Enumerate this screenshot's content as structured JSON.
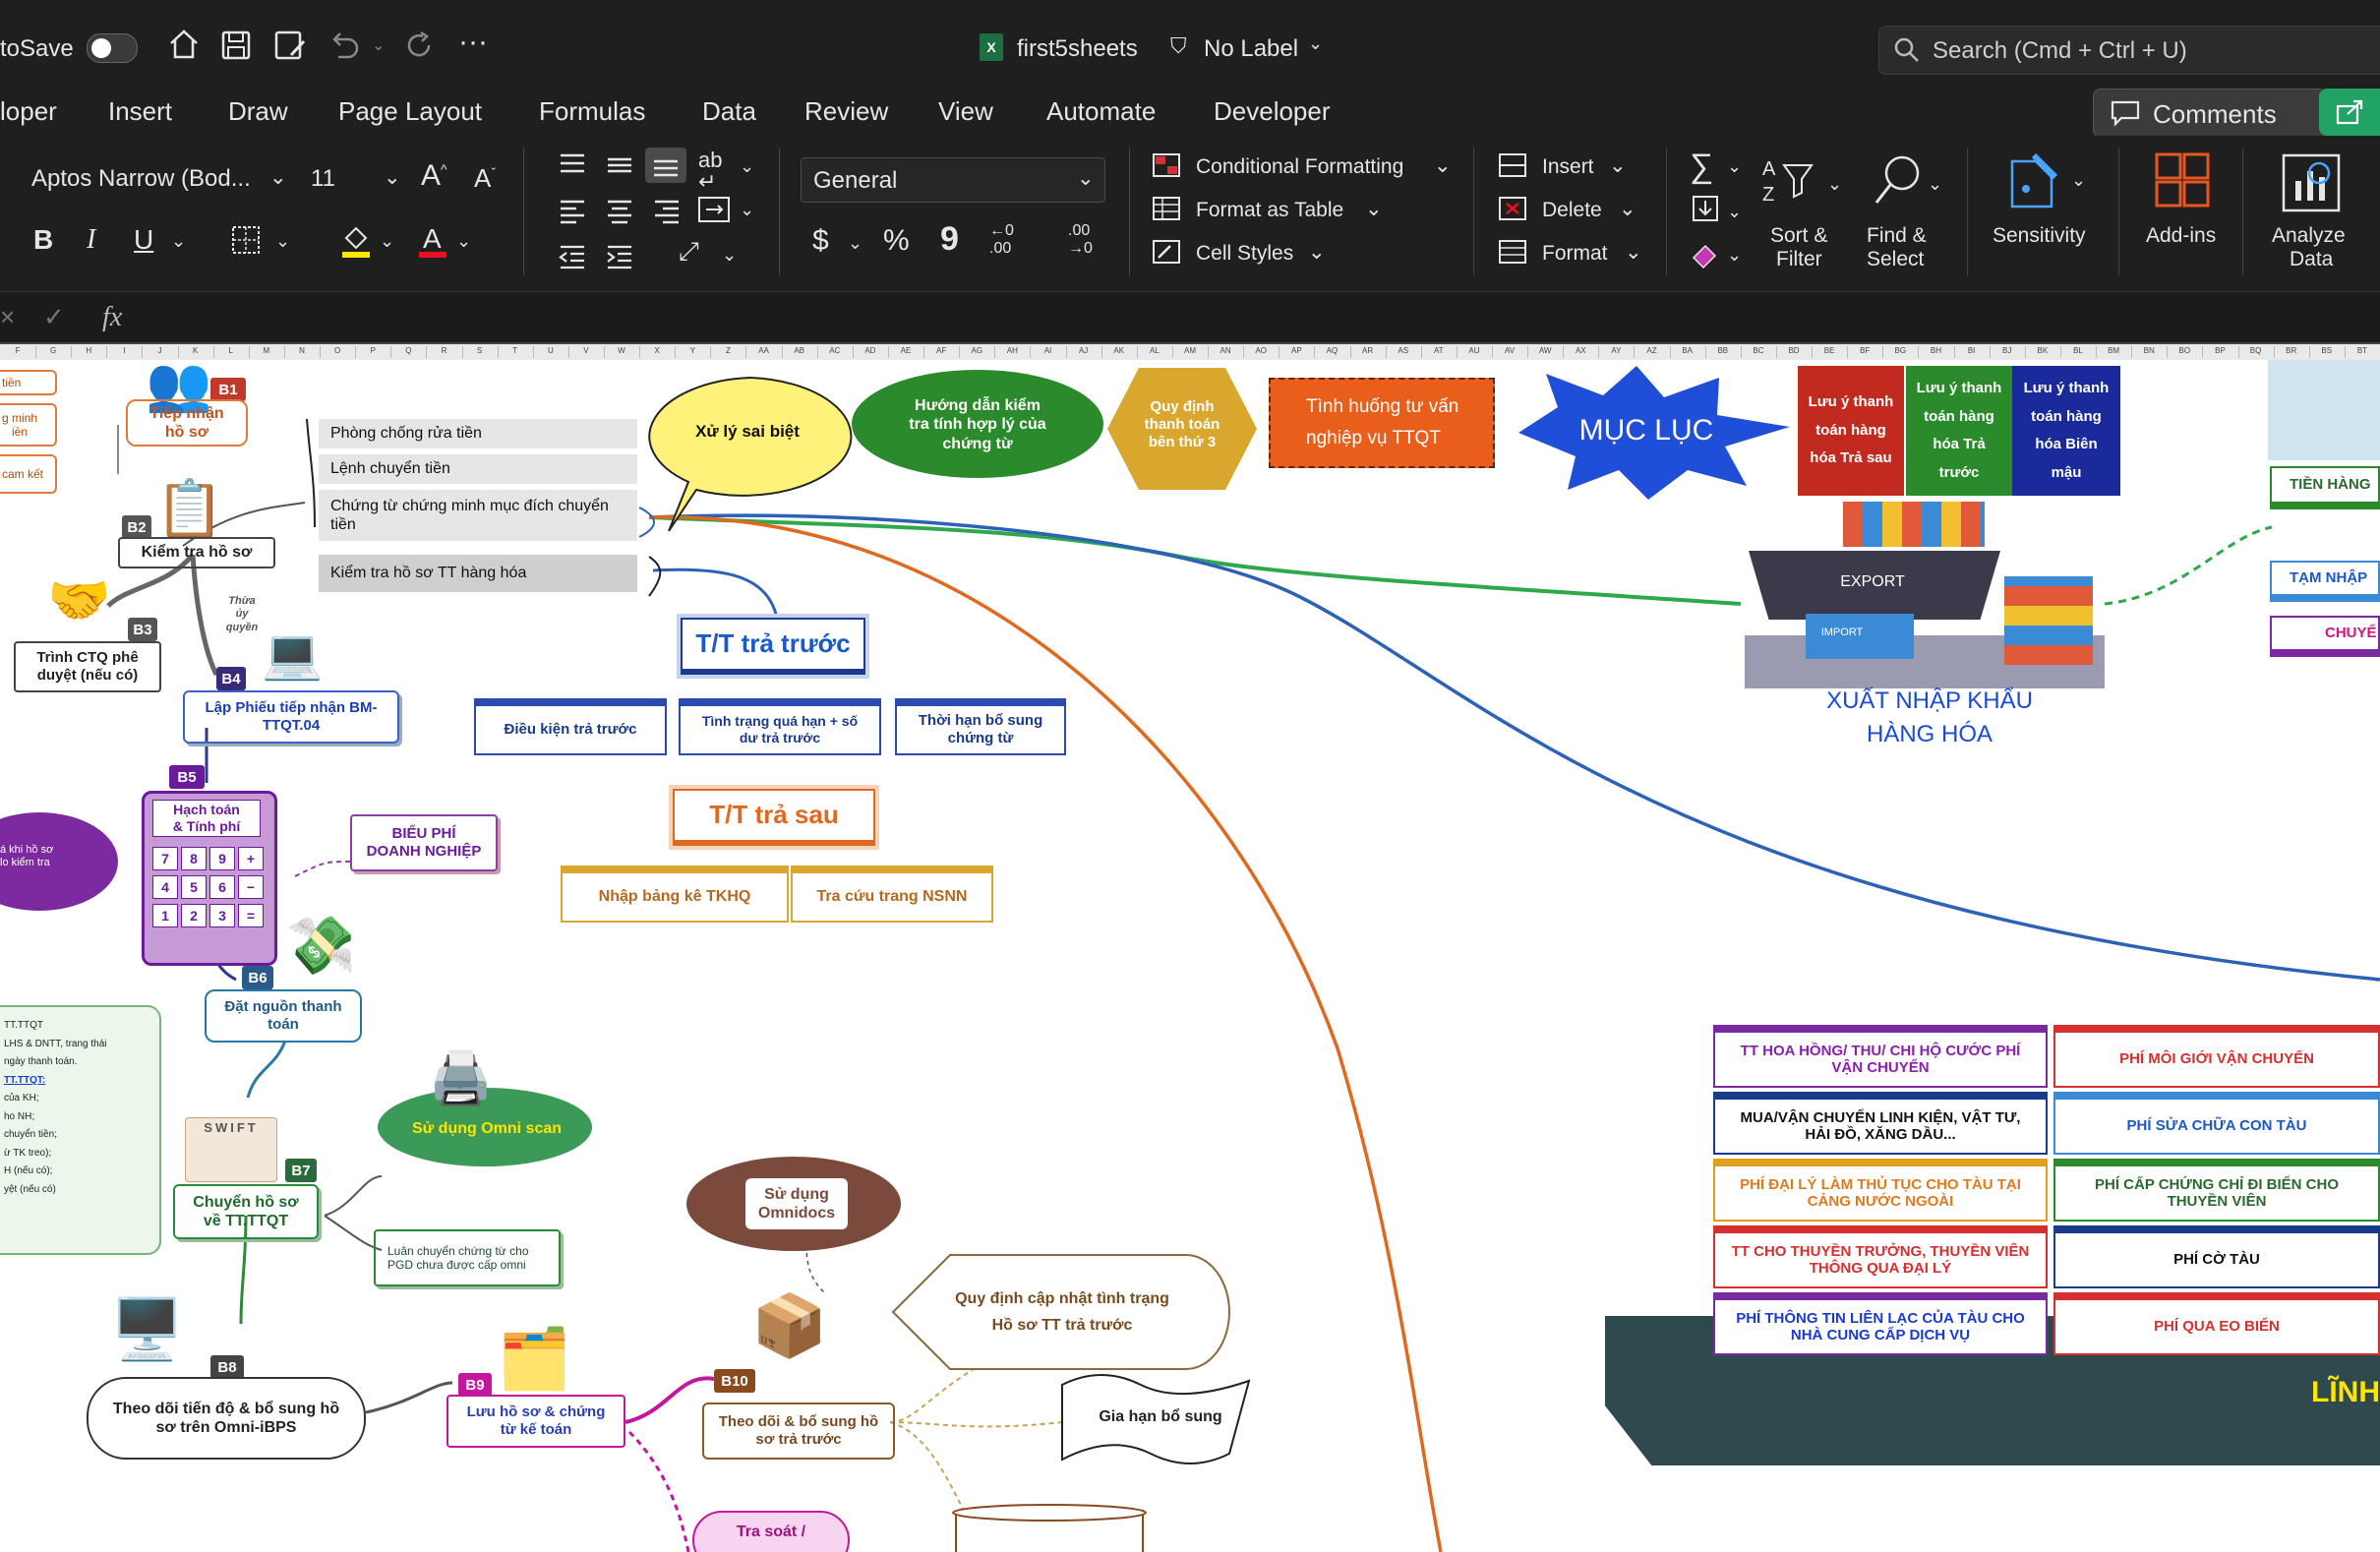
{
  "titlebar": {
    "autosave_label": "toSave",
    "filename": "first5sheets",
    "label_status": "No Label",
    "search_placeholder": "Search (Cmd + Ctrl + U)"
  },
  "menu": {
    "tabs": [
      "loper",
      "Insert",
      "Draw",
      "Page Layout",
      "Formulas",
      "Data",
      "Review",
      "View",
      "Automate",
      "Developer"
    ],
    "comments_label": "Comments"
  },
  "ribbon": {
    "font_name": "Aptos Narrow (Bod...",
    "font_size": "11",
    "number_format": "General",
    "conditional_formatting": "Conditional Formatting",
    "format_as_table": "Format as Table",
    "cell_styles": "Cell Styles",
    "insert": "Insert",
    "delete": "Delete",
    "format": "Format",
    "sort_filter_1": "Sort &",
    "sort_filter_2": "Filter",
    "find_select_1": "Find &",
    "find_select_2": "Select",
    "sensitivity": "Sensitivity",
    "addins": "Add-ins",
    "analyze_1": "Analyze",
    "analyze_2": "Data",
    "bold": "B",
    "italic": "I",
    "underline": "U",
    "currency": "$",
    "percent": "%",
    "comma": "9"
  },
  "formula": {
    "fx": "fx"
  },
  "columns": [
    "F",
    "G",
    "H",
    "I",
    "J",
    "K",
    "L",
    "M",
    "N",
    "O",
    "P",
    "Q",
    "R",
    "S",
    "T",
    "U",
    "V",
    "W",
    "X",
    "Y",
    "Z",
    "AA",
    "AB",
    "AC",
    "AD",
    "AE",
    "AF",
    "AG",
    "AH",
    "AI",
    "AJ",
    "AK",
    "AL",
    "AM",
    "AN",
    "AO",
    "AP",
    "AQ",
    "AR",
    "AS",
    "AT",
    "AU",
    "AV",
    "AW",
    "AX",
    "AY",
    "AZ",
    "BA",
    "BB",
    "BC",
    "BD",
    "BE",
    "BF",
    "BG",
    "BH",
    "BI",
    "BJ",
    "BK",
    "BL",
    "BM",
    "BN",
    "BO",
    "BP",
    "BQ",
    "BR",
    "BS",
    "BT"
  ],
  "diagram": {
    "left_partial": [
      "tiền",
      "g minh\niền",
      "cam kết"
    ],
    "b1": {
      "badge": "B1",
      "label": "Tiếp nhận\nhồ sơ"
    },
    "b2": {
      "badge": "B2",
      "label": "Kiểm tra hồ sơ"
    },
    "b3": {
      "badge": "B3",
      "label": "Trình CTQ phê\nduyệt (nếu có)"
    },
    "b3_note": "Thừa\nủy\nquyền",
    "b4": {
      "badge": "B4",
      "label": "Lập Phiếu tiếp nhận BM-\nTTQT.04"
    },
    "b5": {
      "badge": "B5",
      "label": "Hạch toán\n& Tính phí"
    },
    "b5_fee": "BIỂU PHÍ\nDOANH NGHIỆP",
    "b5_cloud": "á khi hồ sơ\nlo kiểm tra",
    "b6": {
      "badge": "B6",
      "label": "Đặt nguồn thanh\ntoán"
    },
    "b7": {
      "badge": "B7",
      "label": "Chuyển hồ sơ\nvề TT.TTQT",
      "swift": "SWIFT"
    },
    "b7_omni": "Sử dụng Omni scan",
    "b7_note": "Luân chuyển chứng từ cho\nPGD chưa được cấp omni",
    "b8": {
      "badge": "B8",
      "label": "Theo dõi tiến độ & bổ sung hồ\nsơ trên Omni-iBPS"
    },
    "b9": {
      "badge": "B9",
      "label": "Lưu hồ sơ & chứng\ntừ kế toán"
    },
    "b10": {
      "badge": "B10",
      "label": "Theo dõi & bổ sung hồ\nsơ trả trước"
    },
    "omnidocs": "Sử dụng\nOmnidocs",
    "b10_rule": "Quy định cập nhật tình trạng\nHồ sơ TT trả trước",
    "b10_extend": "Gia hạn bổ sung",
    "bottom_pink": "Tra soát /",
    "left_note": [
      "TT.TTQT",
      "LHS & DNTT, trang thái",
      "ngày thanh toán.",
      "TT.TTQT:",
      "của KH;",
      "ho NH;",
      "chuyển tiền;",
      "ừ TK treo);",
      "H (nếu có);",
      "yệt (nếu có)"
    ],
    "b2_items": [
      "Phòng chống rửa tiền",
      "Lệnh chuyển tiền",
      "Chứng từ chứng minh mục đích chuyển\ntiền",
      "Kiểm tra hồ sơ TT hàng hóa"
    ],
    "xu_ly": "Xử lý sai biệt",
    "huong_dan": "Hướng dẫn kiểm\ntra tính hợp lý của\nchứng từ",
    "quy_dinh": "Quy định\nthanh toán\nbên thứ 3",
    "tinh_huong": "Tình huống tư vấn\nnghiệp vụ TTQT",
    "muc_luc": "MỤC LỤC",
    "luu_y": [
      "Lưu ý thanh\ntoán hàng\nhóa Trả sau",
      "Lưu ý thanh\ntoán hàng\nhóa Trả\ntrước",
      "Lưu ý thanh\ntoán hàng\nhóa Biên\nmậu"
    ],
    "tt_tra_truoc": "T/T trả trước",
    "tt_items": [
      "Điều kiện trả trước",
      "Tình trạng quá hạn + số\ndư trả trước",
      "Thời hạn bổ sung\nchứng từ"
    ],
    "tt_tra_sau": "T/T trả sau",
    "ts_items": [
      "Nhập bảng kê TKHQ",
      "Tra cứu trang NSNN"
    ],
    "export_label": "EXPORT",
    "import_label": "IMPORT",
    "xnk": "XUẤT NHẬP KHẨU\nHÀNG HÓA",
    "right_tabs": [
      "TIỀN HÀNG",
      "TẠM NHẬP",
      "CHUYỂ"
    ],
    "fees_left": [
      "TT HOA HỒNG/ THU/ CHI HỘ CƯỚC PHÍ\nVẬN CHUYỂN",
      "MUA/VẬN CHUYỂN LINH KIỆN, VẬT TƯ,\nHẢI ĐỒ, XĂNG DẦU...",
      "PHÍ ĐẠI LÝ LÀM THỦ TỤC CHO TÀU TẠI\nCẢNG NƯỚC NGOÀI",
      "TT CHO THUYỀN TRƯỞNG, THUYỀN VIÊN\nTHÔNG QUA ĐẠI LÝ",
      "PHÍ THÔNG TIN LIÊN LẠC CỦA TÀU CHO\nNHÀ CUNG CẤP DỊCH VỤ"
    ],
    "fees_right": [
      "PHÍ MÔI GIỚI VẬN CHUYỂN",
      "PHÍ SỬA CHỮA CON TÀU",
      "PHÍ CẤP CHỨNG CHỈ ĐI BIỂN CHO\nTHUYỀN VIÊN",
      "PHÍ CỜ TÀU",
      "PHÍ QUA EO BIỂN"
    ],
    "linh": "LĨNH"
  },
  "calc_keys": [
    "7",
    "8",
    "9",
    "+",
    "4",
    "5",
    "6",
    "−",
    "1",
    "2",
    "3",
    "="
  ]
}
